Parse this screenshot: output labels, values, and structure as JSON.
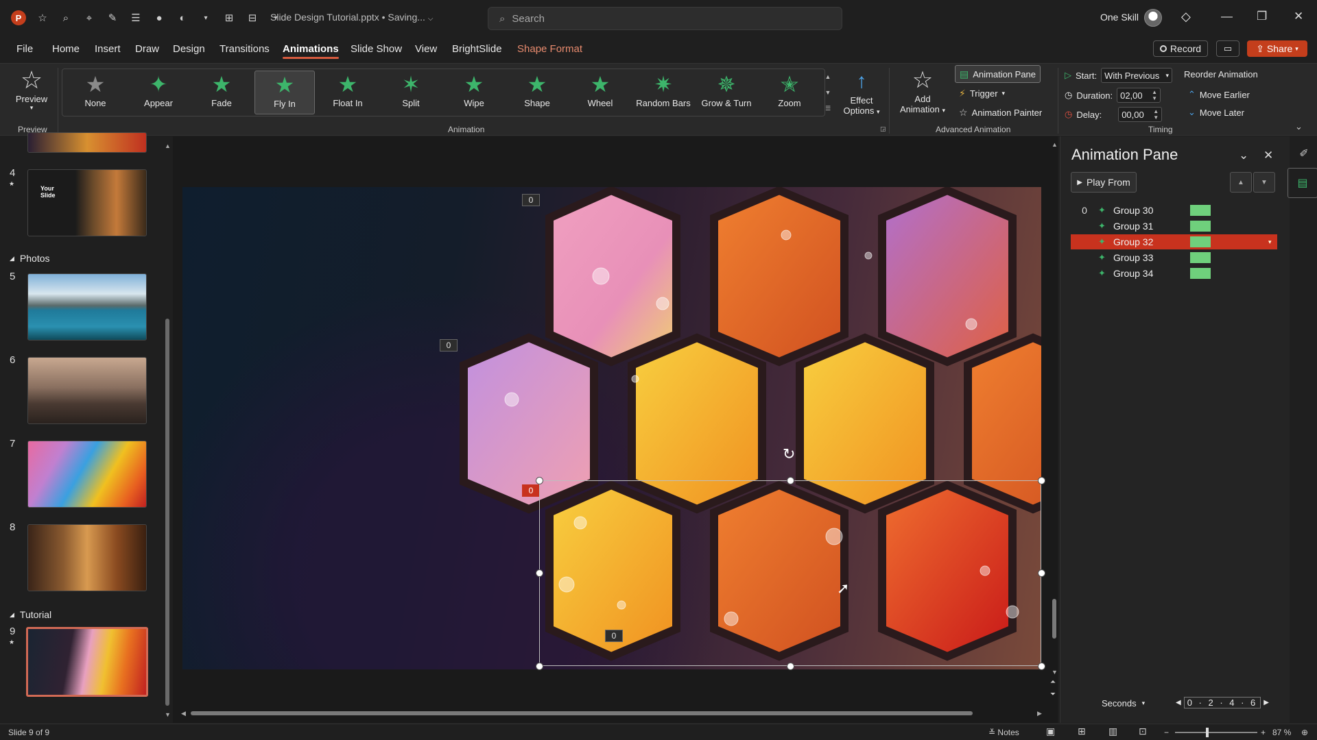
{
  "titlebar": {
    "doc_title": "Slide Design Tutorial.pptx • Saving...",
    "search_placeholder": "Search",
    "account": "One Skill"
  },
  "menu": [
    "File",
    "Home",
    "Insert",
    "Draw",
    "Design",
    "Transitions",
    "Animations",
    "Slide Show",
    "View",
    "BrightSlide",
    "Shape Format"
  ],
  "menu_active": "Animations",
  "actions": {
    "record": "Record",
    "share": "Share"
  },
  "ribbon": {
    "preview": "Preview",
    "preview_group": "Preview",
    "animations": [
      "None",
      "Appear",
      "Fade",
      "Fly In",
      "Float In",
      "Split",
      "Wipe",
      "Shape",
      "Wheel",
      "Random Bars",
      "Grow & Turn",
      "Zoom"
    ],
    "selected_animation": "Fly In",
    "animation_group": "Animation",
    "effect_options_1": "Effect",
    "effect_options_2": "Options",
    "add_animation_1": "Add",
    "add_animation_2": "Animation",
    "animation_pane": "Animation Pane",
    "trigger": "Trigger",
    "animation_painter": "Animation Painter",
    "advanced_group": "Advanced Animation",
    "start_label": "Start:",
    "start_value": "With Previous",
    "duration_label": "Duration:",
    "duration_value": "02,00",
    "delay_label": "Delay:",
    "delay_value": "00,00",
    "reorder": "Reorder Animation",
    "move_earlier": "Move Earlier",
    "move_later": "Move Later",
    "timing_group": "Timing"
  },
  "thumbnails": {
    "sections": {
      "photos": "Photos",
      "tutorial": "Tutorial"
    },
    "slide_numbers": [
      "4",
      "5",
      "6",
      "7",
      "8",
      "9"
    ],
    "slide4_text_1": "Your",
    "slide4_text_2": "Slide"
  },
  "slide": {
    "tags": [
      "0",
      "0",
      "0",
      "0"
    ]
  },
  "pane": {
    "title": "Animation Pane",
    "play_from": "Play From",
    "items": [
      {
        "num": "0",
        "name": "Group 30"
      },
      {
        "num": "",
        "name": "Group 31"
      },
      {
        "num": "",
        "name": "Group 32"
      },
      {
        "num": "",
        "name": "Group 33"
      },
      {
        "num": "",
        "name": "Group 34"
      }
    ],
    "selected_item": "Group 32",
    "seconds": "Seconds",
    "timeline_scale": "0 · 2 · 4 · 6"
  },
  "status": {
    "slide_of": "Slide 9 of 9",
    "notes": "Notes",
    "zoom": "87 %"
  },
  "colors": {
    "accent": "#c43e1c",
    "selection_red": "#c8321e",
    "anim_green": "#3db56b",
    "timeline_bar": "#6fd07c"
  }
}
